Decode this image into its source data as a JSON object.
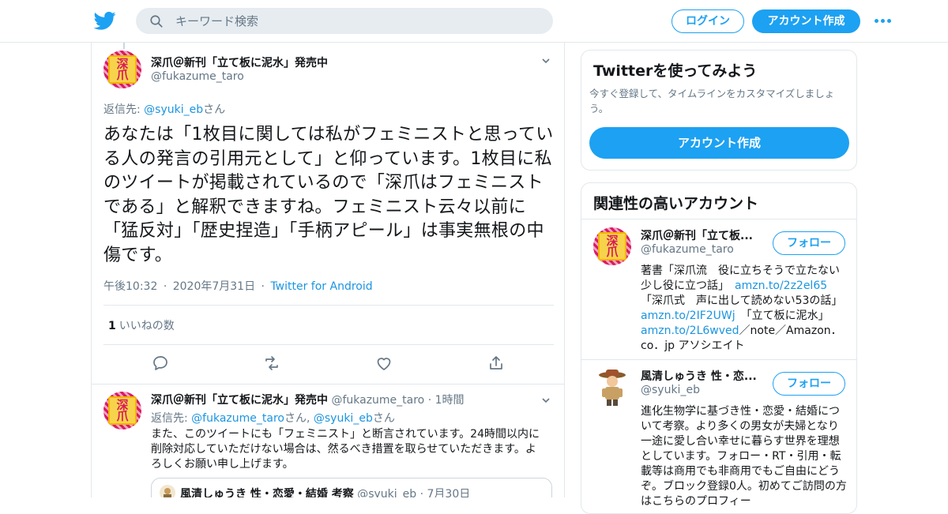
{
  "topbar": {
    "logo_icon": "twitter-bird-icon",
    "search_placeholder": "キーワード検索",
    "login_label": "ログイン",
    "signup_label": "アカウント作成",
    "more_icon": "more-dots-icon",
    "brand_color": "#1da1f2"
  },
  "main_tweet": {
    "author_name": "深爪＠新刊「立て板に泥水」発売中",
    "author_handle": "@fukazume_taro",
    "avatar_text_1": "深",
    "avatar_text_2": "爪",
    "reply_prefix": "返信先: ",
    "reply_handle": "@syuki_eb",
    "reply_suffix": "さん",
    "text": "あなたは「1枚目に関しては私がフェミニストと思っている人の発言の引用元として」と仰っています。1枚目に私のツイートが掲載されているので「深爪はフェミニストである」と解釈できますね。フェミニスト云々以前に「猛反対」「歴史捏造」「手柄アピール」は事実無根の中傷です。",
    "time": "午後10:32",
    "date": "2020年7月31日",
    "source": "Twitter for Android",
    "like_count": "1",
    "like_label": "いいねの数",
    "actions": [
      "reply-icon",
      "retweet-icon",
      "like-icon",
      "share-icon"
    ]
  },
  "reply_tweet": {
    "author_name": "深爪＠新刊「立て板に泥水」発売中",
    "author_handle": "@fukazume_taro",
    "time_ago": "1時間",
    "reply_prefix": "返信先: ",
    "reply_handle_1": "@fukazume_taro",
    "reply_mid": "さん, ",
    "reply_handle_2": "@syuki_eb",
    "reply_suffix": "さん",
    "text": "また、このツイートにも「フェミニスト」と断言されています。24時間以内に削除対応していただけない場合は、然るべき措置を取らせていただきます。よろしくお願い申し上げます。",
    "quote": {
      "author_name": "風清しゅうき 性・恋愛・結婚 考察",
      "author_handle": "@syuki_eb",
      "date": "7月30日"
    }
  },
  "sidebar": {
    "signup_card": {
      "title": "Twitterを使ってみよう",
      "subtitle": "今すぐ登録して、タイムラインをカスタマイズしましょう。",
      "button_label": "アカウント作成"
    },
    "related": {
      "title": "関連性の高いアカウント",
      "accounts": [
        {
          "name": "深爪＠新刊「立て板...",
          "handle": "@fukazume_taro",
          "follow_label": "フォロー",
          "bio_1": "著書「深爪流　役に立ちそうで立たない少し役に立つ話」　",
          "bio_link_1": "amzn.to/2z2el65",
          "bio_2": "「深爪式　声に出して読めない53の話」",
          "bio_link_2": "amzn.to/2IF2UWj",
          "bio_3": "　「立て板に泥水」",
          "bio_link_3": "amzn.to/2L6wved",
          "bio_4": "／note／Amazon．co．jp アソシエイト"
        },
        {
          "name": "風清しゅうき 性・恋...",
          "handle": "@syuki_eb",
          "follow_label": "フォロー",
          "bio_1": "進化生物学に基づき性・恋愛・結婚について考察。より多くの男女が夫婦となり一途に愛し合い幸せに暮らす世界を理想としています。フォロー・RT・引用・転載等は商用でも非商用でもご自由にどうぞ。ブロック登録0人。初めてご訪問の方はこちらのプロフィー"
        }
      ]
    }
  }
}
